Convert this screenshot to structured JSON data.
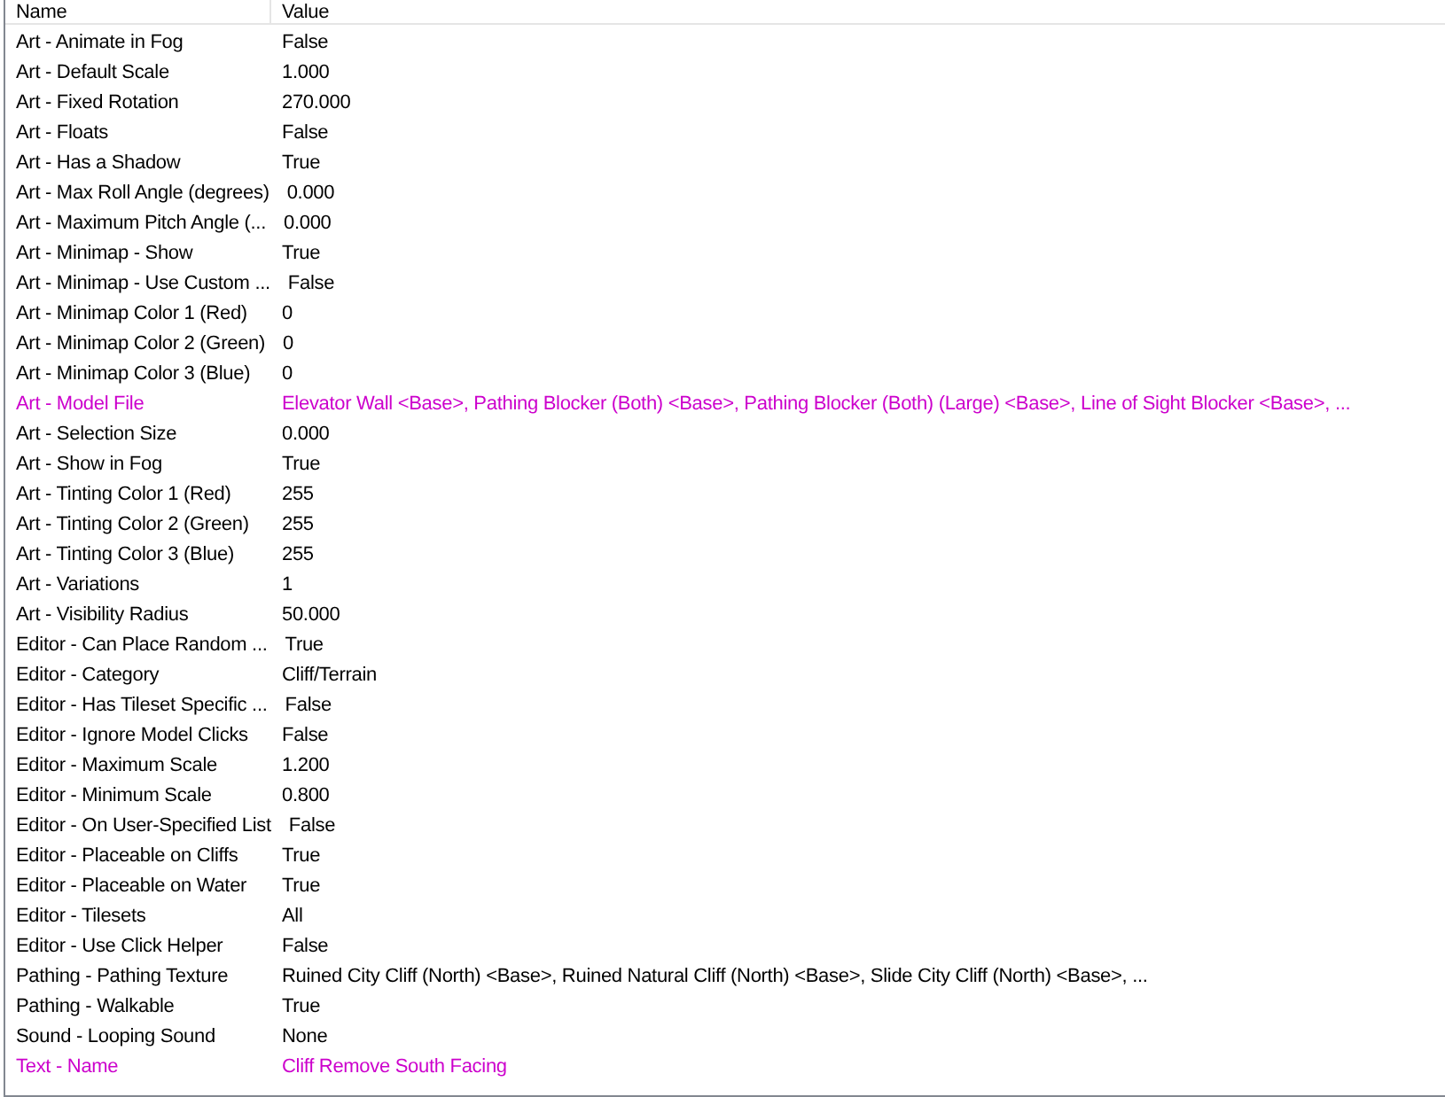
{
  "columns": [
    "Name",
    "Value"
  ],
  "rows": [
    {
      "name": "Art - Animate in Fog",
      "value": "False",
      "modified": false
    },
    {
      "name": "Art - Default Scale",
      "value": "1.000",
      "modified": false
    },
    {
      "name": "Art - Fixed Rotation",
      "value": "270.000",
      "modified": false
    },
    {
      "name": "Art - Floats",
      "value": "False",
      "modified": false
    },
    {
      "name": "Art - Has a Shadow",
      "value": "True",
      "modified": false
    },
    {
      "name": "Art - Max Roll Angle (degrees)",
      "value": "0.000",
      "modified": false
    },
    {
      "name": "Art - Maximum Pitch Angle (...",
      "value": "0.000",
      "modified": false
    },
    {
      "name": "Art - Minimap - Show",
      "value": "True",
      "modified": false
    },
    {
      "name": "Art - Minimap - Use Custom ...",
      "value": "False",
      "modified": false
    },
    {
      "name": "Art - Minimap Color 1 (Red)",
      "value": "0",
      "modified": false
    },
    {
      "name": "Art - Minimap Color 2 (Green)",
      "value": "0",
      "modified": false
    },
    {
      "name": "Art - Minimap Color 3 (Blue)",
      "value": "0",
      "modified": false
    },
    {
      "name": "Art - Model File",
      "value": "Elevator Wall <Base>, Pathing Blocker (Both) <Base>, Pathing Blocker (Both) (Large) <Base>, Line of Sight Blocker <Base>, ...",
      "modified": true
    },
    {
      "name": "Art - Selection Size",
      "value": "0.000",
      "modified": false
    },
    {
      "name": "Art - Show in Fog",
      "value": "True",
      "modified": false
    },
    {
      "name": "Art - Tinting Color 1 (Red)",
      "value": "255",
      "modified": false
    },
    {
      "name": "Art - Tinting Color 2 (Green)",
      "value": "255",
      "modified": false
    },
    {
      "name": "Art - Tinting Color 3 (Blue)",
      "value": "255",
      "modified": false
    },
    {
      "name": "Art - Variations",
      "value": "1",
      "modified": false
    },
    {
      "name": "Art - Visibility Radius",
      "value": "50.000",
      "modified": false
    },
    {
      "name": "Editor - Can Place Random ...",
      "value": "True",
      "modified": false
    },
    {
      "name": "Editor - Category",
      "value": "Cliff/Terrain",
      "modified": false
    },
    {
      "name": "Editor - Has Tileset Specific ...",
      "value": "False",
      "modified": false
    },
    {
      "name": "Editor - Ignore Model Clicks",
      "value": "False",
      "modified": false
    },
    {
      "name": "Editor - Maximum Scale",
      "value": "1.200",
      "modified": false
    },
    {
      "name": "Editor - Minimum Scale",
      "value": "0.800",
      "modified": false
    },
    {
      "name": "Editor - On User-Specified List",
      "value": "False",
      "modified": false
    },
    {
      "name": "Editor - Placeable on Cliffs",
      "value": "True",
      "modified": false
    },
    {
      "name": "Editor - Placeable on Water",
      "value": "True",
      "modified": false
    },
    {
      "name": "Editor - Tilesets",
      "value": "All",
      "modified": false
    },
    {
      "name": "Editor - Use Click Helper",
      "value": "False",
      "modified": false
    },
    {
      "name": "Pathing - Pathing Texture",
      "value": "Ruined City Cliff (North) <Base>, Ruined Natural Cliff (North) <Base>, Slide City Cliff (North) <Base>, ...",
      "modified": false
    },
    {
      "name": "Pathing - Walkable",
      "value": "True",
      "modified": false
    },
    {
      "name": "Sound - Looping Sound",
      "value": "None",
      "modified": false
    },
    {
      "name": "Text - Name",
      "value": "Cliff Remove South Facing",
      "modified": true
    }
  ]
}
